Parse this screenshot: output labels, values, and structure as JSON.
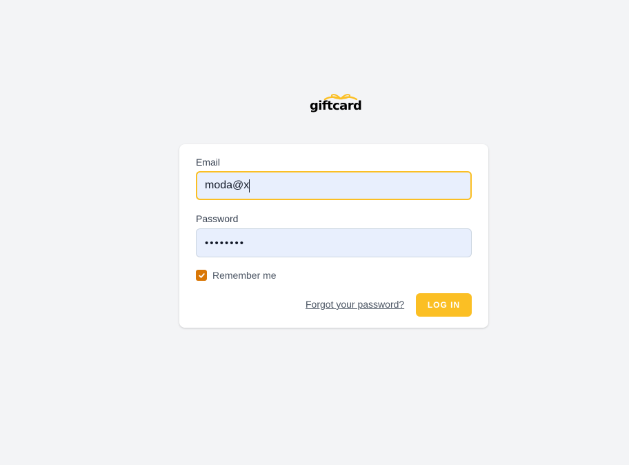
{
  "brand": {
    "name": "giftcard",
    "accent": "#fbbf24",
    "icon": "gift-bow-icon"
  },
  "form": {
    "email_label": "Email",
    "email_value": "moda@x",
    "password_label": "Password",
    "password_value_masked": "••••••••",
    "remember_label": "Remember me",
    "remember_checked": true,
    "forgot_link": "Forgot your password?",
    "login_button": "LOG IN"
  },
  "colors": {
    "background": "#f3f4f6",
    "card": "#ffffff",
    "input_fill": "#e8effd",
    "focus_border": "#fbbf24",
    "checkbox": "#d97706"
  }
}
